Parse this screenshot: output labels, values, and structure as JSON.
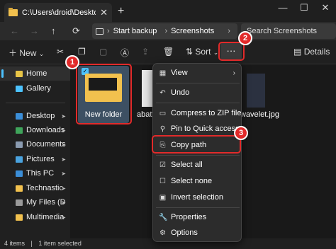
{
  "window": {
    "tab_title": "C:\\Users\\droid\\Desktop\\",
    "tab_close": "✕",
    "new_tab": "+",
    "minimize": "—",
    "maximize": "☐",
    "close": "✕"
  },
  "nav": {
    "back": "←",
    "forward": "→",
    "up": "↑",
    "refresh": "⟳",
    "breadcrumb": [
      "Start backup",
      "Screenshots"
    ],
    "breadcrumb_sep": "›",
    "more_crumbs": "›",
    "search_placeholder": "Search Screenshots"
  },
  "toolbar": {
    "new_label": "New",
    "sort_label": "Sort",
    "more_label": "···",
    "details_label": "Details"
  },
  "sidebar": {
    "items": [
      {
        "label": "Home",
        "color": "#e8c547"
      },
      {
        "label": "Gallery",
        "color": "#4cc2ff"
      },
      {
        "label": "Desktop",
        "color": "#3b8ed8"
      },
      {
        "label": "Downloads",
        "color": "#3fa55b"
      },
      {
        "label": "Documents",
        "color": "#8a9bb0"
      },
      {
        "label": "Pictures",
        "color": "#4aa3df"
      },
      {
        "label": "This PC",
        "color": "#3b8ed8"
      },
      {
        "label": "Technastic",
        "color": "#f2c14e"
      },
      {
        "label": "My Files (D",
        "color": "#9a9a9a"
      },
      {
        "label": "Multimedia",
        "color": "#f2c14e"
      }
    ],
    "pin": "📌"
  },
  "content": {
    "files": [
      {
        "label": "New folder"
      },
      {
        "label": "abatt"
      },
      {
        "label": "wavelet.jpg"
      }
    ]
  },
  "status": {
    "items_count": "4 items",
    "selected": "1 item selected"
  },
  "menu": {
    "items": [
      {
        "label": "View",
        "icon": "▦"
      },
      {
        "label": "Undo",
        "icon": "↶"
      },
      {
        "label": "Compress to ZIP file",
        "icon": "▭"
      },
      {
        "label": "Pin to Quick access",
        "icon": "⚲"
      },
      {
        "label": "Copy path",
        "icon": "⎘"
      },
      {
        "label": "Select all",
        "icon": "☑"
      },
      {
        "label": "Select none",
        "icon": "☐"
      },
      {
        "label": "Invert selection",
        "icon": "▣"
      },
      {
        "label": "Properties",
        "icon": "🔧"
      },
      {
        "label": "Options",
        "icon": "⚙"
      }
    ],
    "chevron": "›"
  },
  "callouts": {
    "badge1": "1",
    "badge2": "2",
    "badge3": "3",
    "color": "#e22a2a"
  },
  "colors": {
    "accent": "#4cc2ff",
    "folder": "#f2c14e"
  }
}
